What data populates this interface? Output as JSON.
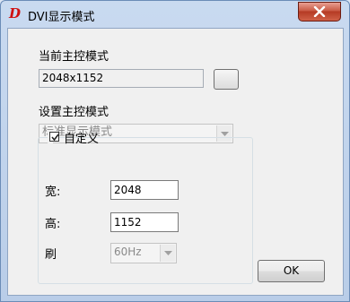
{
  "window": {
    "title": "DVI显示模式",
    "app_icon_glyph": "D",
    "close_glyph": "x"
  },
  "current_mode": {
    "label": "当前主控模式",
    "value": "2048x1152"
  },
  "set_mode": {
    "label": "设置主控模式",
    "combo_value": "标准显示模式"
  },
  "custom": {
    "checkbox_label": "自定义",
    "checked": true,
    "width_label": "宽:",
    "width_value": "2048",
    "height_label": "高:",
    "height_value": "1152",
    "refresh_label": "刷",
    "refresh_value": "60Hz"
  },
  "ok_label": "OK"
}
